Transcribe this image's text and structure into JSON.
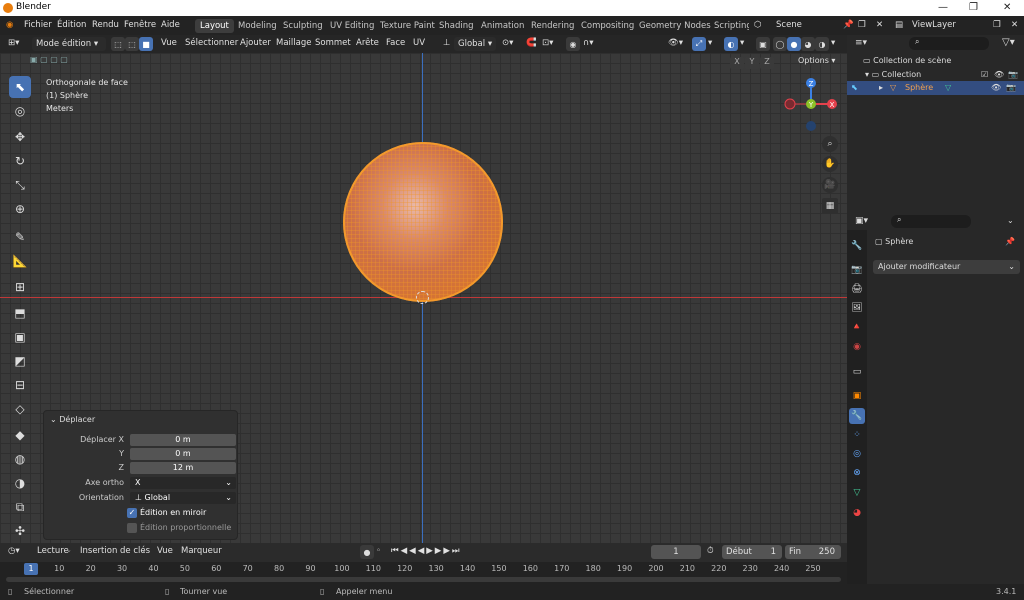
{
  "window": {
    "title": "Blender",
    "min": "—",
    "max": "❐",
    "close": "✕"
  },
  "menu": [
    "Fichier",
    "Édition",
    "Rendu",
    "Fenêtre",
    "Aide"
  ],
  "workspaces": [
    "Layout",
    "Modeling",
    "Sculpting",
    "UV Editing",
    "Texture Paint",
    "Shading",
    "Animation",
    "Rendering",
    "Compositing",
    "Geometry Nodes",
    "Scripting"
  ],
  "scene": "Scene",
  "view_layer": "ViewLayer",
  "viewport_header": {
    "mode": "Mode édition",
    "items": [
      "Vue",
      "Sélectionner",
      "Ajouter",
      "Maillage",
      "Sommet",
      "Arête",
      "Face",
      "UV"
    ],
    "orientation": "Global",
    "options": "Options",
    "axes": [
      "X",
      "Y",
      "Z"
    ]
  },
  "viewport_info": {
    "line1": "Orthogonale de face",
    "line2": "(1) Sphère",
    "line3": "Meters"
  },
  "gizmo": {
    "x": "X",
    "y": "Y",
    "z": "Z"
  },
  "operator_panel": {
    "title": "Déplacer",
    "rows": [
      {
        "label": "Déplacer X",
        "value": "0 m"
      },
      {
        "label": "Y",
        "value": "0 m"
      },
      {
        "label": "Z",
        "value": "12 m"
      }
    ],
    "axis_label": "Axe ortho",
    "axis_value": "X",
    "orientation_label": "Orientation",
    "orientation_value": "Global",
    "mirror": "Édition en miroir",
    "proportional": "Édition proportionnelle"
  },
  "timeline": {
    "menu": [
      "Lecture",
      "Insertion de clés",
      "Vue",
      "Marqueur"
    ],
    "current_frame": "1",
    "start_label": "Début",
    "start": "1",
    "end_label": "Fin",
    "end": "250",
    "ticks": [
      "1",
      "10",
      "20",
      "30",
      "40",
      "50",
      "60",
      "70",
      "80",
      "90",
      "100",
      "110",
      "120",
      "130",
      "140",
      "150",
      "160",
      "170",
      "180",
      "190",
      "200",
      "210",
      "220",
      "230",
      "240",
      "250"
    ]
  },
  "status": {
    "select": "Sélectionner",
    "rotate": "Tourner vue",
    "menu": "Appeler menu",
    "version": "3.4.1"
  },
  "outliner": {
    "scene_collection": "Collection de scène",
    "collection": "Collection",
    "object": "Sphère"
  },
  "properties": {
    "object": "Sphère",
    "add_modifier": "Ajouter modificateur"
  },
  "colors": {
    "accent": "#4772b3",
    "sphere": "#e08a22",
    "x_axis": "#e4414c",
    "y_axis": "#8dc228",
    "z_axis": "#3b80e4"
  }
}
